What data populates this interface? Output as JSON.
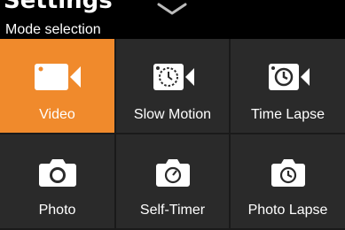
{
  "peek": {
    "text": "Settings"
  },
  "header": {
    "title": "Mode selection"
  },
  "modes": [
    {
      "label": "Video",
      "icon": "video-camera-icon",
      "active": true
    },
    {
      "label": "Slow Motion",
      "icon": "slow-motion-icon",
      "active": false
    },
    {
      "label": "Time Lapse",
      "icon": "time-lapse-video-icon",
      "active": false
    },
    {
      "label": "Photo",
      "icon": "photo-camera-icon",
      "active": false
    },
    {
      "label": "Self-Timer",
      "icon": "self-timer-camera-icon",
      "active": false
    },
    {
      "label": "Photo Lapse",
      "icon": "photo-lapse-camera-icon",
      "active": false
    }
  ],
  "colors": {
    "accent": "#f08a2c",
    "tile": "#2a2a2a",
    "background": "#000000",
    "text": "#ffffff"
  }
}
